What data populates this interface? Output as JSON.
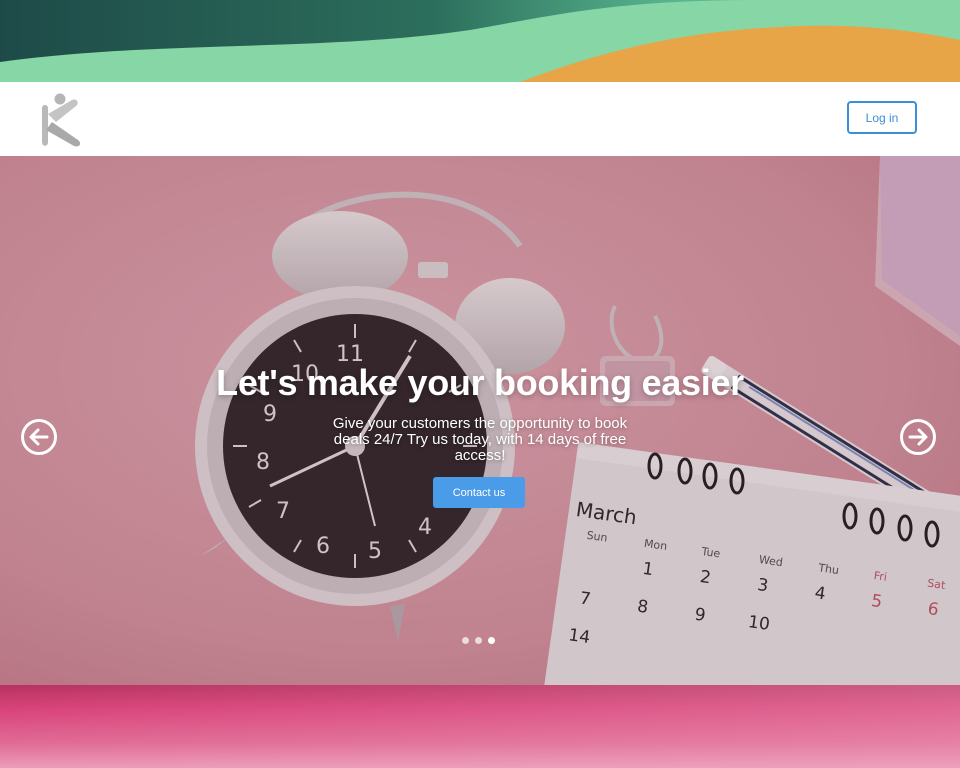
{
  "header": {
    "logo_icon": "person-k-logo-icon",
    "login_label": "Log in"
  },
  "hero": {
    "title": "Let's make your booking easier",
    "subtitle": "Give your customers the opportunity to book deals 24/7 Try us today, with 14 days of free access!",
    "cta_label": "Contact us",
    "prev_icon": "arrow-left-circle-icon",
    "next_icon": "arrow-right-circle-icon",
    "slides_total": 3,
    "active_slide": 3,
    "calendar": {
      "month": "March",
      "weekdays": [
        "Sun",
        "Mon",
        "Tue",
        "Wed",
        "Thu",
        "Fri",
        "Sat"
      ],
      "days": [
        "1",
        "2",
        "3",
        "4",
        "5",
        "6",
        "7",
        "8",
        "9",
        "10",
        "14"
      ]
    }
  },
  "colors": {
    "accent": "#3b8fd8",
    "cta": "#4a9be8",
    "hero_bg": "#d89ba7",
    "top_band": "#7fcfa3",
    "bottom_band": "#d9447a"
  }
}
